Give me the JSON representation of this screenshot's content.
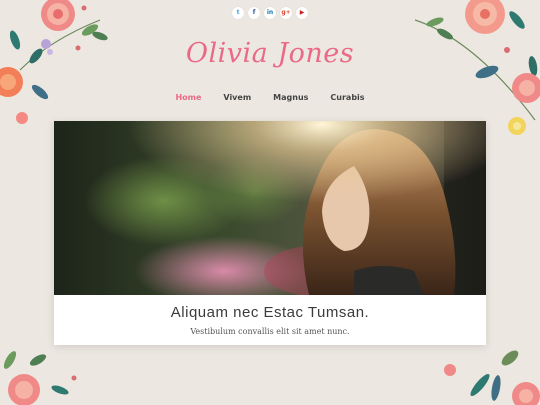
{
  "social": [
    {
      "name": "twitter-icon",
      "glyph": "t",
      "cls": "tw"
    },
    {
      "name": "facebook-icon",
      "glyph": "f",
      "cls": "fb"
    },
    {
      "name": "linkedin-icon",
      "glyph": "in",
      "cls": "li"
    },
    {
      "name": "googleplus-icon",
      "glyph": "g+",
      "cls": "gp"
    },
    {
      "name": "youtube-icon",
      "glyph": "▶",
      "cls": "yt"
    }
  ],
  "site": {
    "title": "Olivia Jones"
  },
  "nav": {
    "items": [
      "Home",
      "Vivem",
      "Magnus",
      "Curabis"
    ],
    "active_index": 0
  },
  "featured": {
    "title": "Aliquam nec Estac Tumsan.",
    "subtitle": "Vestibulum convallis elit sit amet nunc."
  },
  "colors": {
    "accent": "#ea6a86",
    "background": "#ece7e1"
  }
}
